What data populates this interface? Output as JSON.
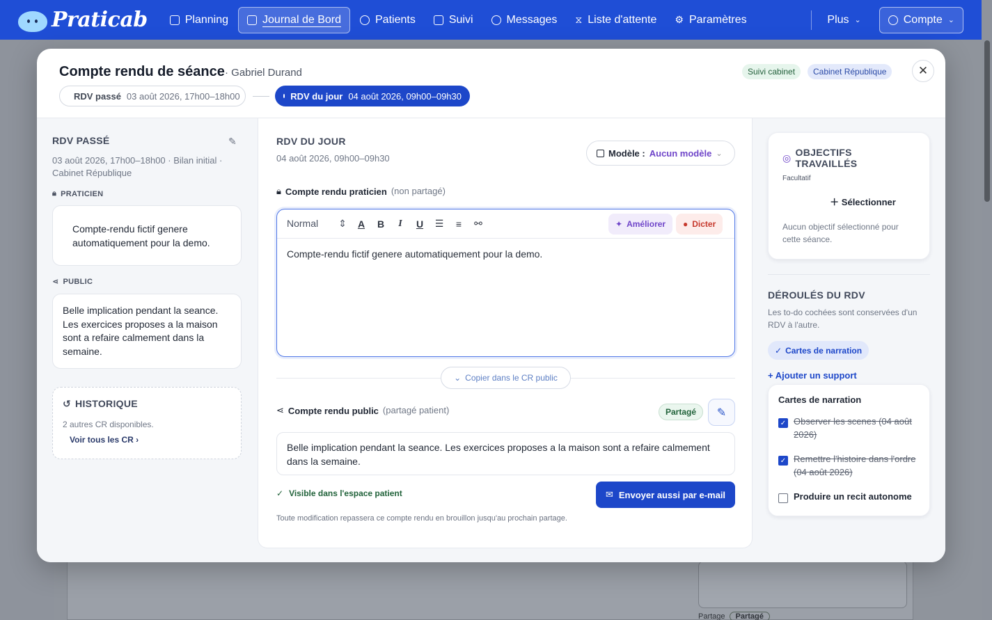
{
  "nav": {
    "brand": "Praticab",
    "items": [
      {
        "label": "Planning",
        "icon": "calendar-icon",
        "active": false
      },
      {
        "label": "Journal de Bord",
        "icon": "journal-icon",
        "active": true
      },
      {
        "label": "Patients",
        "icon": "users-icon",
        "active": false
      },
      {
        "label": "Suivi",
        "icon": "edit-icon",
        "active": false
      },
      {
        "label": "Messages",
        "icon": "message-icon",
        "active": false
      },
      {
        "label": "Liste d'attente",
        "icon": "hourglass-icon",
        "active": false
      },
      {
        "label": "Paramètres",
        "icon": "gear-icon",
        "active": false
      }
    ],
    "more": "Plus",
    "account": "Compte"
  },
  "modal": {
    "title": "Compte rendu de séance",
    "patient": "· Gabriel Durand",
    "tags": [
      "Suivi cabinet",
      "Cabinet République"
    ],
    "rdv_past": {
      "label": "RDV passé",
      "date": "03 août 2026, 17h00–18h00"
    },
    "rdv_today": {
      "label": "RDV du jour",
      "date": "04 août 2026, 09h00–09h30"
    }
  },
  "left": {
    "heading": "RDV PASSÉ",
    "meta": "03 août 2026, 17h00–18h00 · Bilan initial · Cabinet République",
    "praticien_label": "PRATICIEN",
    "praticien_text": "Compte-rendu fictif genere automatiquement pour la demo.",
    "public_label": "PUBLIC",
    "public_text": "Belle implication pendant la seance. Les exercices proposes a la maison sont a refaire calmement dans la semaine.",
    "history_label": "HISTORIQUE",
    "history_count": "2 autres CR disponibles.",
    "history_link": "Voir tous les CR"
  },
  "center": {
    "heading": "RDV DU JOUR",
    "date": "04 août 2026, 09h00–09h30",
    "model_label": "Modèle :",
    "model_value": "Aucun modèle",
    "praticien_title": "Compte rendu praticien",
    "praticien_note": "(non partagé)",
    "toolbar_format": "Normal",
    "improve": "Améliorer",
    "dictate": "Dicter",
    "editor_text": "Compte-rendu fictif genere automatiquement pour la demo.",
    "copy_btn": "Copier dans le CR public",
    "public_title": "Compte rendu public",
    "public_note": "(partagé patient)",
    "shared_badge": "Partagé",
    "public_text": "Belle implication pendant la seance. Les exercices proposes a la maison sont a refaire calmement dans la semaine.",
    "visible": "Visible dans l'espace patient",
    "send_btn": "Envoyer aussi par e-mail",
    "footnote": "Toute modification repassera ce compte rendu en brouillon jusqu'au prochain partage."
  },
  "right": {
    "objectives_title": "OBJECTIFS TRAVAILLÉS",
    "objectives_optional": "Facultatif",
    "select_btn": "Sélectionner",
    "objectives_empty": "Aucun objectif sélectionné pour cette séance.",
    "deroules_title": "DÉROULÉS DU RDV",
    "deroules_desc": "Les to-do cochées sont conservées d'un RDV à l'autre.",
    "chip": "Cartes de narration",
    "add_support": "+ Ajouter un support",
    "todo_title": "Cartes de narration",
    "todos": [
      {
        "label": "Observer les scenes (04 août 2026)",
        "checked": true
      },
      {
        "label": "Remettre l'histoire dans l'ordre (04 août 2026)",
        "checked": true
      },
      {
        "label": "Produire un recit autonome",
        "checked": false
      }
    ]
  },
  "background": {
    "share_label": "Partage",
    "share_pill": "Partagé"
  }
}
